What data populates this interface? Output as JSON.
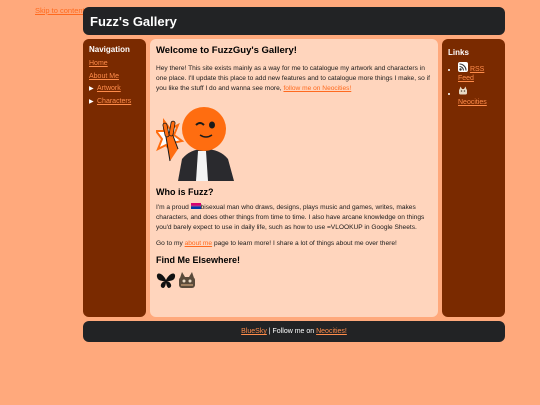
{
  "skip_link": "Skip to content",
  "site": {
    "title": "Fuzz's Gallery"
  },
  "nav": {
    "heading": "Navigation",
    "items": [
      {
        "label": "Home"
      },
      {
        "label": "About Me"
      },
      {
        "label": "Artwork"
      },
      {
        "label": "Characters"
      }
    ]
  },
  "main": {
    "welcome_heading": "Welcome to FuzzGuy's Gallery!",
    "intro_text": "Hey there! This site exists mainly as a way for me to catalogue my artwork and characters in one place. I'll update this place to add new features and to catalogue more things I make, so if you like the stuff I do and wanna see more,",
    "intro_link": "follow me on Neocities!",
    "who_heading": "Who is Fuzz?",
    "who_text_1": "I'm a proud",
    "who_text_2": "bisexual man who draws, designs, plays music and games, writes, makes characters, and does other things from time to time. I also have arcane knowledge on things you'd barely expect to use in daily life, such as how to use =VLOOKUP in Google Sheets.",
    "goto_before": "Go to my",
    "goto_link": "about me",
    "goto_after": "page to learn more! I share a lot of things about me over there!",
    "find_heading": "Find Me Elsewhere!",
    "icons": [
      "butterfly-icon",
      "neocities-cat-icon"
    ]
  },
  "links": {
    "heading": "Links",
    "items": [
      {
        "label": "RSS Feed",
        "icon": "rss-icon"
      },
      {
        "label": "Neocities",
        "icon": "neocities-cat-icon"
      }
    ]
  },
  "footer": {
    "link1": "BlueSky",
    "separator_text": " | Follow me on ",
    "link2": "Neocities!"
  },
  "colors": {
    "page_bg": "#ffa97c",
    "panel_dark": "#222325",
    "sidebar": "#7a2a00",
    "content_bg": "#ffd5bd",
    "link": "#ff6a1e",
    "mascot_orange": "#ff6d10"
  }
}
